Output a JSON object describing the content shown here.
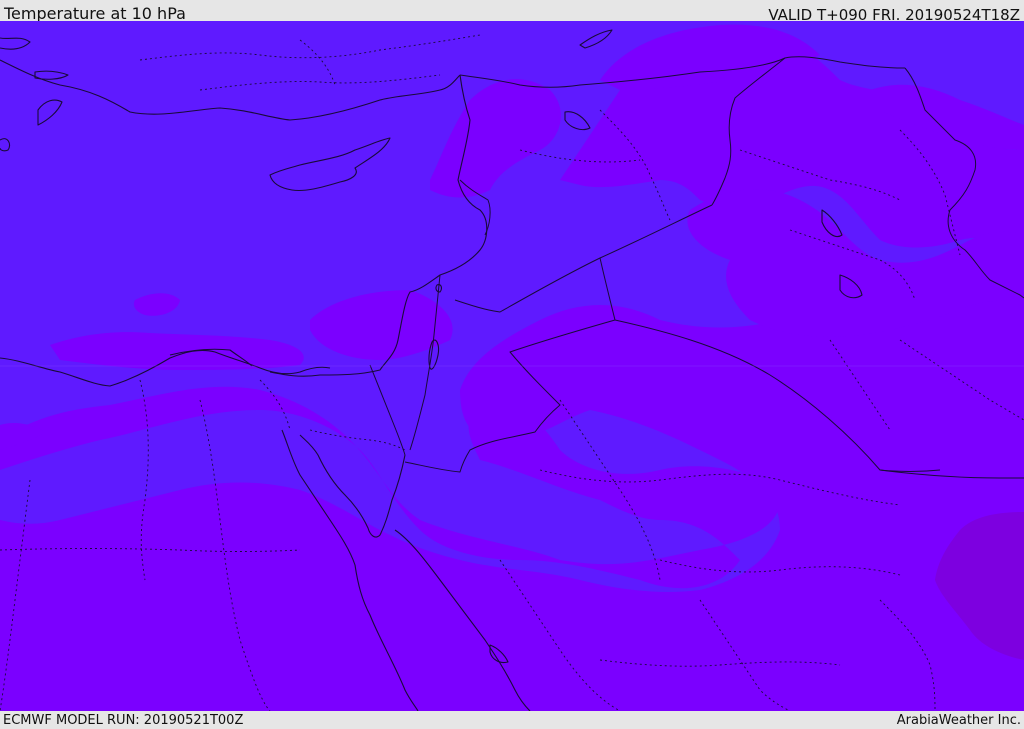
{
  "header": {
    "title": "Temperature at 10 hPa",
    "valid": "VALID T+090 FRI. 20190524T18Z"
  },
  "footer": {
    "model_run": "ECMWF MODEL RUN: 20190521T00Z",
    "credit": "ArabiaWeather Inc."
  },
  "map": {
    "colors": {
      "band_cool": "#5f1aff",
      "band_mid": "#7b00ff",
      "band_warm": "#7d00e0",
      "coastline": "#1a0a3a",
      "border": "#1a0a3a"
    }
  }
}
